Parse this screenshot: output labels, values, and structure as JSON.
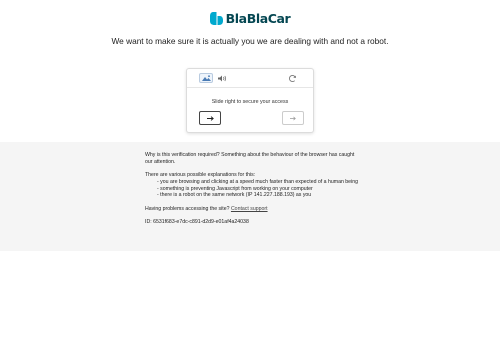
{
  "brand": {
    "name": "BlaBlaCar",
    "color": "#054752",
    "mark_color": "#00a9ce"
  },
  "headline": "We want to make sure it is actually you we are dealing with and not a robot.",
  "captcha": {
    "tabs": [
      {
        "icon": "image-icon",
        "active": true
      },
      {
        "icon": "audio-icon",
        "active": false
      }
    ],
    "refresh_icon": "refresh-icon",
    "instruction": "Slide right to secure your access",
    "handle_icon": "arrow-right-icon",
    "target_icon": "arrow-right-icon"
  },
  "info": {
    "question": "Why is this verification required? Something about the behaviour of the browser has caught our attention.",
    "explanations_intro": "There are various possible explanations for this:",
    "explanations": [
      "- you are browsing and clicking at a speed much faster than expected of a human being",
      "- something is preventing Javascript from working on your computer",
      "- there is a robot on the same network (IP 141.227.188.193) as you"
    ],
    "problem_text": "Having problems accessing the site?",
    "support_link": "Contact support",
    "id_line": "ID: 6531f683-e7dc-c891-d2d9-e01af4a24038"
  }
}
